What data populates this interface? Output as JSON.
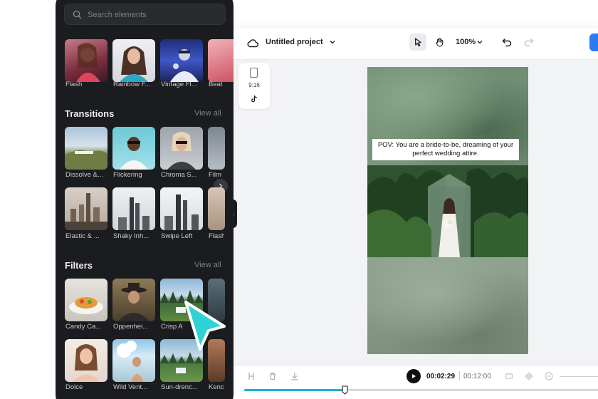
{
  "editor": {
    "project_name": "Untitled project",
    "zoom": "100%",
    "ratio_label": "9:16",
    "caption": "POV: You are a bride-to-be, dreaming of your perfect wedding attire.",
    "time_current": "00:02:29",
    "time_total": "00:12:00",
    "timeline_progress": 0.28,
    "icons": [
      "cloud-icon",
      "pointer-icon",
      "hand-icon",
      "undo-icon",
      "redo-icon",
      "tiktok-icon",
      "split-icon",
      "delete-icon",
      "download-icon",
      "play-icon"
    ]
  },
  "panel": {
    "search_placeholder": "Search elements",
    "top_row_labels": [
      "Flash",
      "Rainbow F...",
      "Vintage Fl...",
      "Beat"
    ],
    "transitions": {
      "title": "Transitions",
      "view_all": "View all",
      "row1": [
        "Dissolve &...",
        "Flickering",
        "Chroma S...",
        "Film"
      ],
      "row2": [
        "Elastic & ...",
        "Shaky Inh...",
        "Swipe Left",
        "Flash"
      ]
    },
    "filters": {
      "title": "Filters",
      "view_all": "View all",
      "row1": [
        "Candy Ca...",
        "Oppenhei...",
        "Crisp A",
        ""
      ],
      "row2": [
        "Dolce",
        "Wild Vent...",
        "Sun-drenc...",
        "Kenc"
      ]
    }
  },
  "colors": {
    "panel_bg": "#1b1c1f",
    "accent": "#19b5cf",
    "cursor": "#2ed3d6",
    "primary_button": "#2b7cf0"
  }
}
